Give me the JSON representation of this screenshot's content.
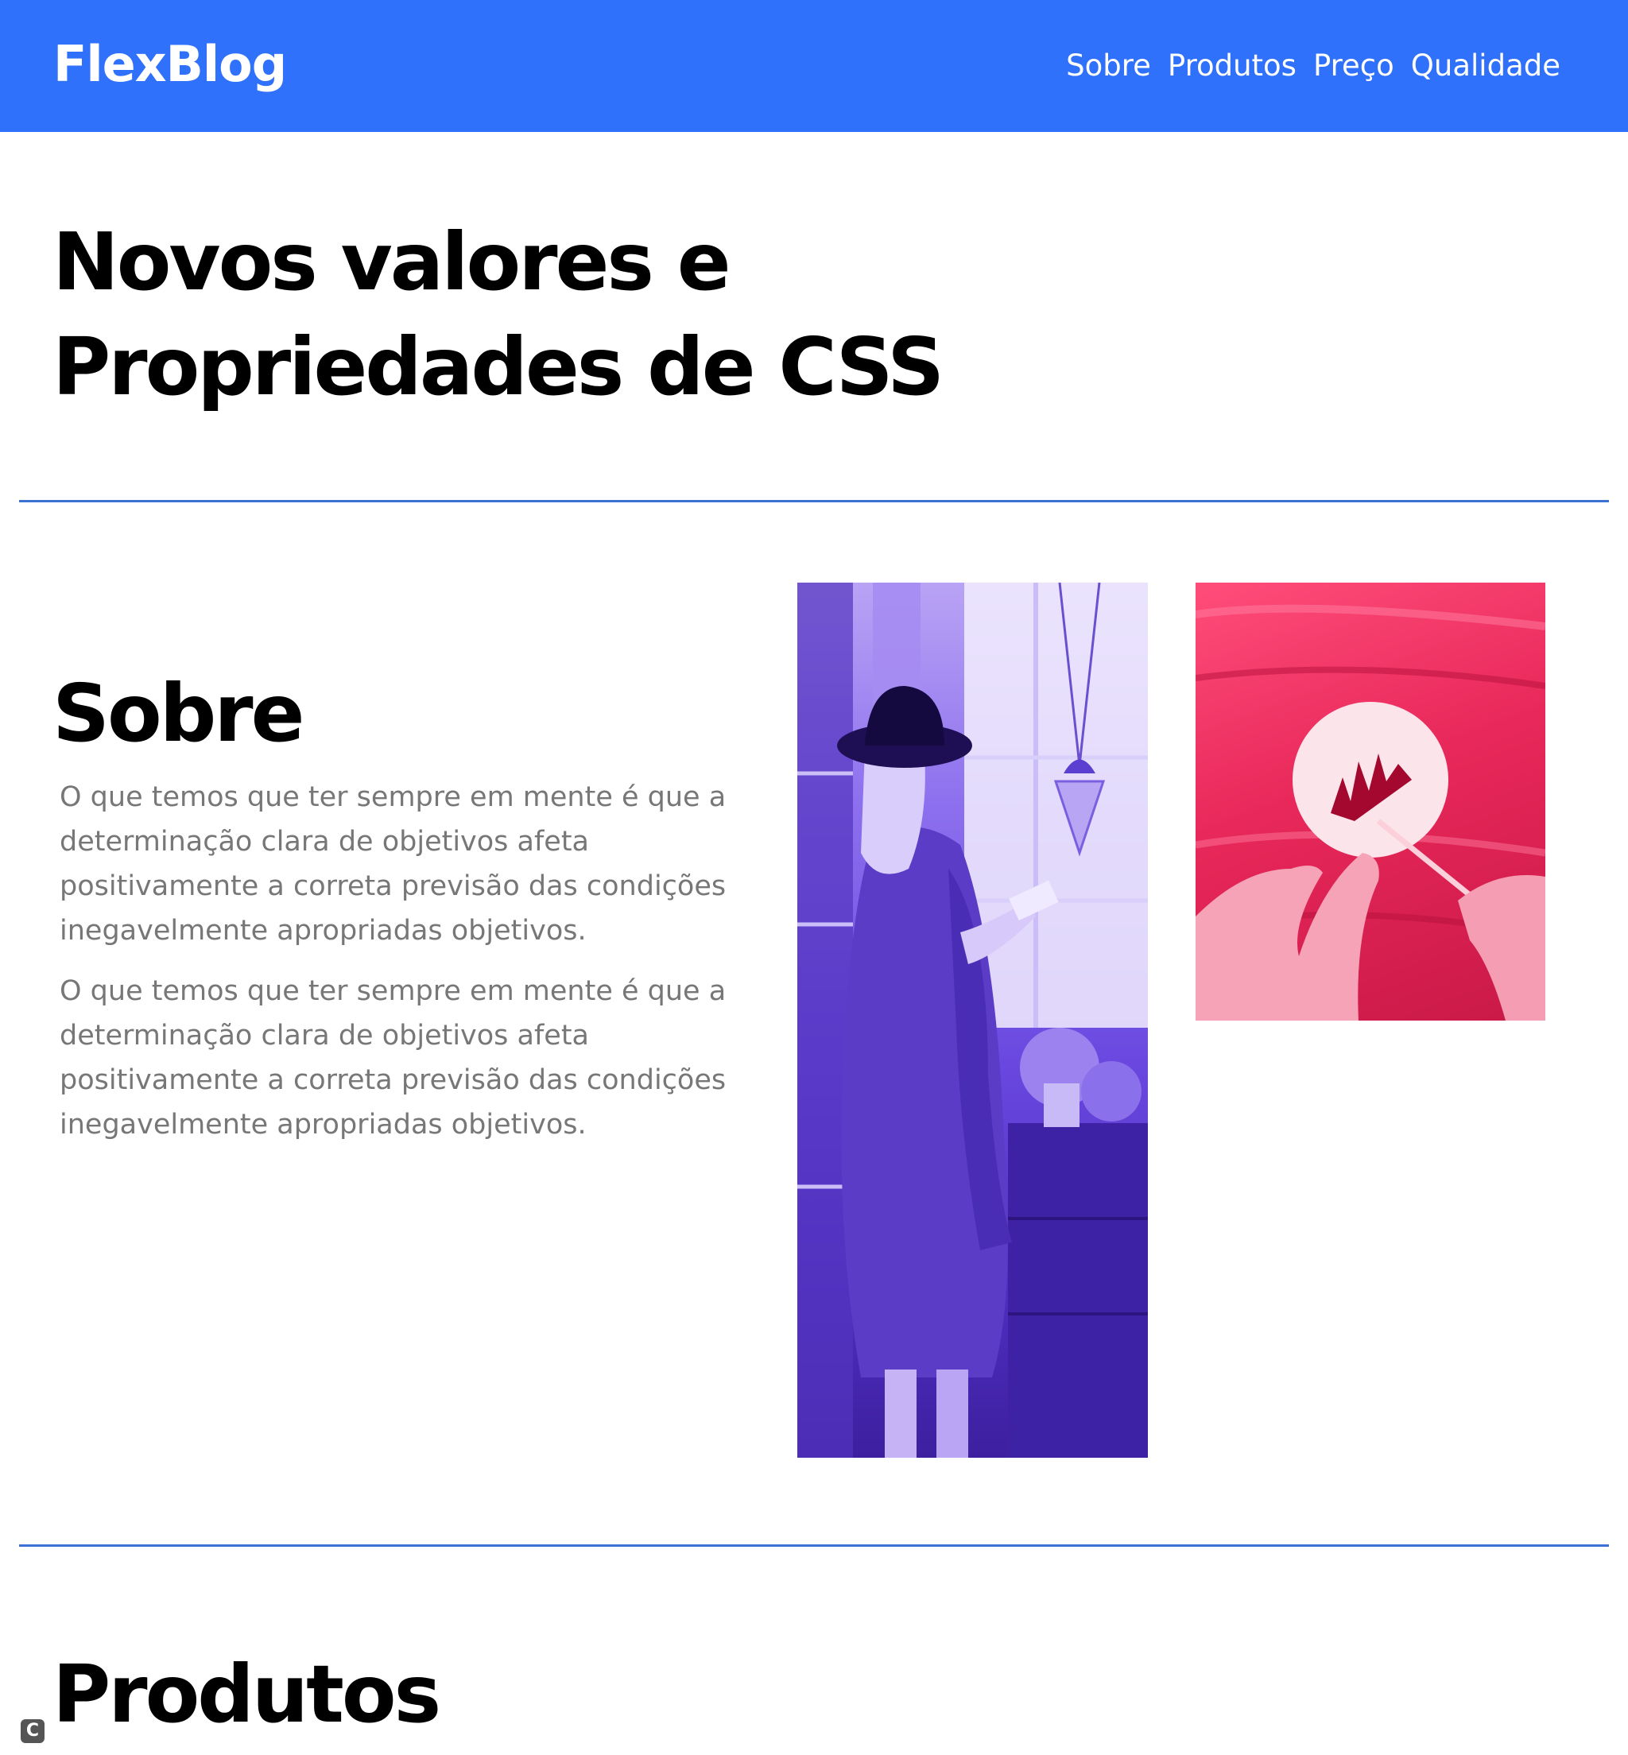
{
  "header": {
    "logo": "FlexBlog",
    "nav": [
      "Sobre",
      "Produtos",
      "Preço",
      "Qualidade"
    ]
  },
  "hero": {
    "title": "Novos valores e Propriedades de CSS"
  },
  "sobre": {
    "title": "Sobre",
    "paragraphs": [
      "O que temos que ter sempre em mente é que a determinação clara de objetivos afeta positivamente a correta previsão das condições inegavelmente apropriadas objetivos.",
      "O que temos que ter sempre em mente é que a determinação clara de objetivos afeta positivamente a correta previsão das condições inegavelmente apropriadas objetivos."
    ]
  },
  "produtos": {
    "title": "Produtos"
  },
  "side_badge": "C",
  "colors": {
    "header_bg": "#3071fb",
    "divider": "#3b72d4",
    "body_text": "#777777"
  }
}
